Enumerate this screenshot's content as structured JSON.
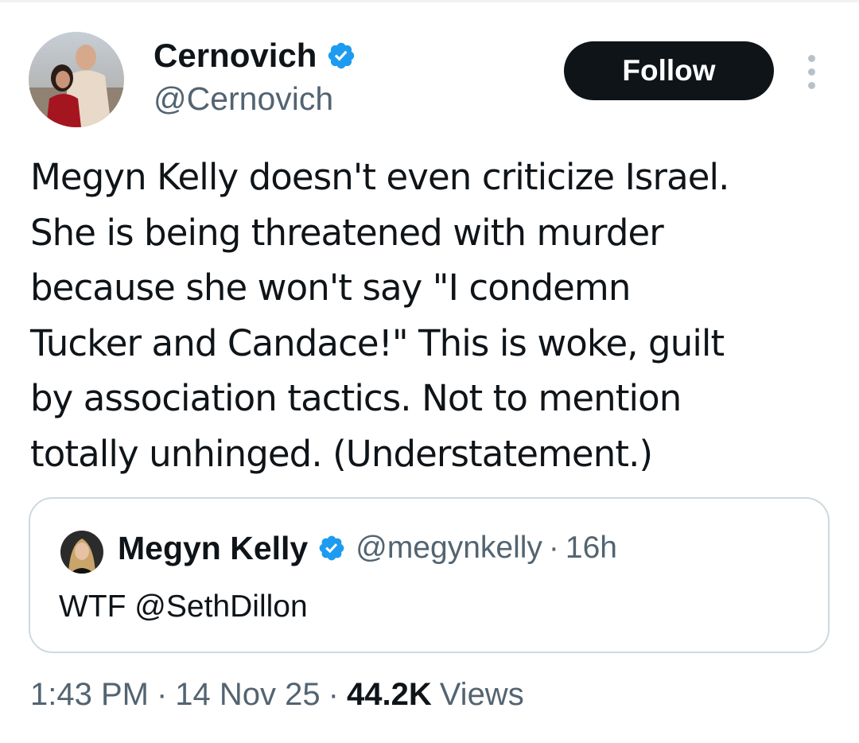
{
  "author": {
    "name": "Cernovich",
    "handle": "@Cernovich",
    "verified": true
  },
  "follow_label": "Follow",
  "more_icon": "more-vertical-icon",
  "tweet": {
    "text": "Megyn Kelly doesn't even criticize Israel.\nShe is being threatened with murder\nbecause she won't say \"I condemn\nTucker and Candace!\" This is woke, guilt\nby association tactics. Not to mention\ntotally unhinged. (Understatement.)"
  },
  "quoted": {
    "name": "Megyn Kelly",
    "handle": "@megynkelly",
    "separator": "·",
    "time": "16h",
    "text": "WTF @SethDillon",
    "verified": true
  },
  "meta": {
    "time": "1:43 PM",
    "separator": "·",
    "date": "14 Nov 25",
    "views_count": "44.2K",
    "views_label": "Views"
  },
  "colors": {
    "verified_blue": "#1d9bf0",
    "text_primary": "#0f1419",
    "text_secondary": "#536471",
    "border": "#cfd9de",
    "follow_bg": "#0f1419"
  }
}
